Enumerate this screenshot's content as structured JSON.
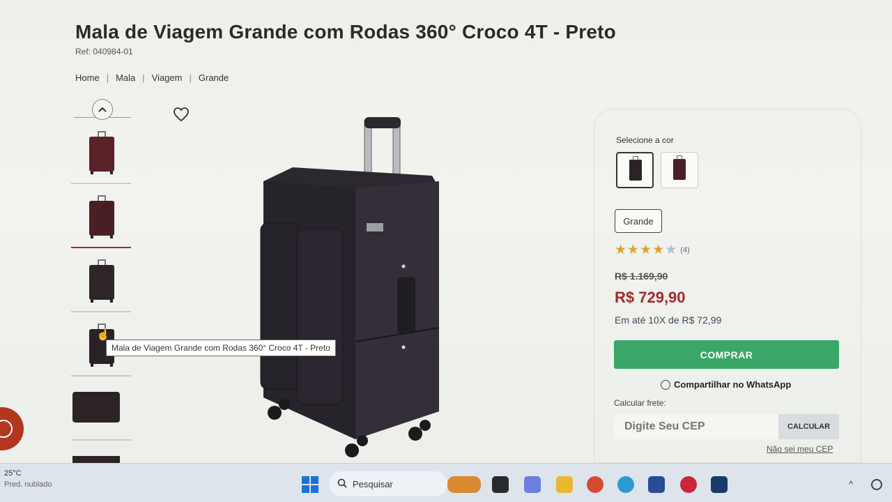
{
  "product": {
    "title": "Mala de Viagem Grande com Rodas 360° Croco 4T - Preto",
    "ref": "Ref: 040984-01"
  },
  "breadcrumb": [
    "Home",
    "Mala",
    "Viagem",
    "Grande"
  ],
  "breadcrumb_separator": "|",
  "gallery": {
    "up_arrow": "^",
    "tooltip": "Mala de Viagem Grande com Rodas 360° Croco 4T - Preto"
  },
  "purchase": {
    "color_label": "Selecione a cor",
    "size_option": "Grande",
    "rating": {
      "stars": 4,
      "max": 5,
      "count_label": "(4)"
    },
    "old_price": "R$ 1.169,90",
    "price": "R$ 729,90",
    "installments": "Em até 10X de R$ 72,99",
    "buy_label": "COMPRAR",
    "share_label": "Compartilhar no WhatsApp",
    "shipping_label": "Calcular frete:",
    "cep_placeholder": "Digite Seu CEP",
    "calc_label": "CALCULAR",
    "cep_link": "Não sei meu CEP"
  },
  "taskbar": {
    "temperature": "25°C",
    "weather": "Pred. nublado",
    "search_label": "Pesquisar"
  },
  "colors": {
    "buy_green": "#3aa668",
    "price_red": "#a8262c",
    "star_gold": "#e0a030"
  }
}
